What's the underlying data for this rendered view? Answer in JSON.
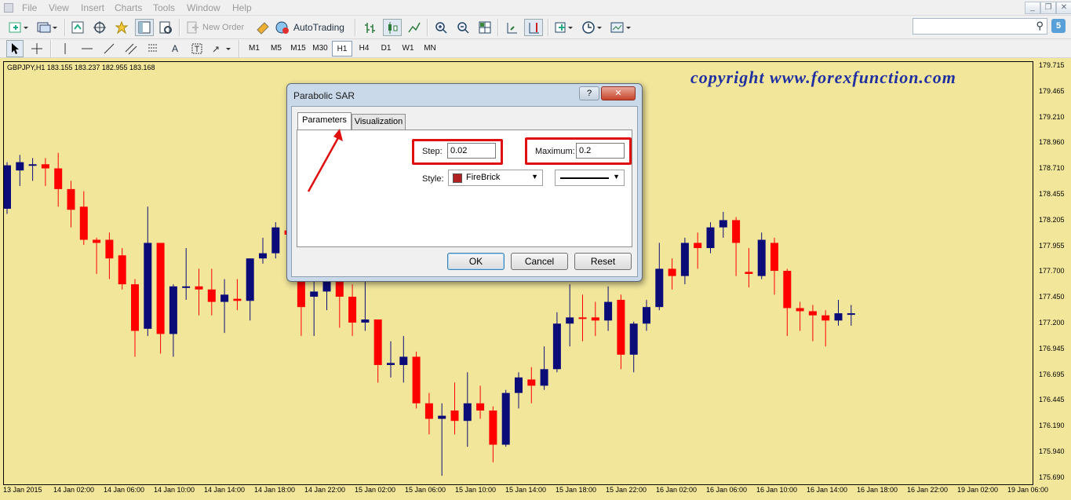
{
  "menu": [
    "File",
    "View",
    "Insert",
    "Charts",
    "Tools",
    "Window",
    "Help"
  ],
  "toolbar": {
    "new_order": "New Order",
    "autotrading": "AutoTrading",
    "search_placeholder": "",
    "badge": "5"
  },
  "timeframes": [
    "M1",
    "M5",
    "M15",
    "M30",
    "H1",
    "H4",
    "D1",
    "W1",
    "MN"
  ],
  "active_timeframe": "H1",
  "chart": {
    "info": "GBPJPY,H1  183.155 183.237 182.955 183.168",
    "copyright": "copyright  www.forexfunction.com",
    "background": "#f2e69b",
    "bull_color": "#0c0c78",
    "bear_color": "#ff0000"
  },
  "chart_data": {
    "type": "candlestick",
    "symbol": "GBPJPY",
    "timeframe": "H1",
    "ylim": [
      175.69,
      179.71
    ],
    "y_ticks": [
      "179.715",
      "179.465",
      "179.210",
      "178.960",
      "178.710",
      "178.455",
      "178.205",
      "177.955",
      "177.700",
      "177.450",
      "177.200",
      "176.945",
      "176.695",
      "176.445",
      "176.190",
      "175.940",
      "175.690"
    ],
    "x_ticks": [
      "13 Jan 2015",
      "14 Jan 02:00",
      "14 Jan 06:00",
      "14 Jan 10:00",
      "14 Jan 14:00",
      "14 Jan 18:00",
      "14 Jan 22:00",
      "15 Jan 02:00",
      "15 Jan 06:00",
      "15 Jan 10:00",
      "15 Jan 14:00",
      "15 Jan 18:00",
      "15 Jan 22:00",
      "16 Jan 02:00",
      "16 Jan 06:00",
      "16 Jan 10:00",
      "16 Jan 14:00",
      "16 Jan 18:00",
      "16 Jan 22:00",
      "19 Jan 02:00",
      "19 Jan 06:00"
    ],
    "candles": [
      {
        "o": 178.33,
        "c": 178.75,
        "h": 178.78,
        "l": 178.28
      },
      {
        "o": 178.7,
        "c": 178.78,
        "h": 178.85,
        "l": 178.55
      },
      {
        "o": 178.76,
        "c": 178.76,
        "h": 178.82,
        "l": 178.6
      },
      {
        "o": 178.76,
        "c": 178.72,
        "h": 178.82,
        "l": 178.55
      },
      {
        "o": 178.72,
        "c": 178.52,
        "h": 178.87,
        "l": 178.35
      },
      {
        "o": 178.52,
        "c": 178.32,
        "h": 178.6,
        "l": 178.15
      },
      {
        "o": 178.35,
        "c": 178.03,
        "h": 178.5,
        "l": 177.98
      },
      {
        "o": 178.03,
        "c": 178.0,
        "h": 178.05,
        "l": 177.7
      },
      {
        "o": 178.03,
        "c": 177.85,
        "h": 178.1,
        "l": 177.65
      },
      {
        "o": 177.88,
        "c": 177.6,
        "h": 177.95,
        "l": 177.55
      },
      {
        "o": 177.6,
        "c": 177.15,
        "h": 177.65,
        "l": 176.9
      },
      {
        "o": 177.17,
        "c": 178.0,
        "h": 178.35,
        "l": 177.1
      },
      {
        "o": 178.0,
        "c": 177.12,
        "h": 178.0,
        "l": 176.93
      },
      {
        "o": 177.12,
        "c": 177.58,
        "h": 177.6,
        "l": 176.9
      },
      {
        "o": 177.58,
        "c": 177.58,
        "h": 177.95,
        "l": 177.45
      },
      {
        "o": 177.58,
        "c": 177.55,
        "h": 177.75,
        "l": 177.3
      },
      {
        "o": 177.55,
        "c": 177.43,
        "h": 177.75,
        "l": 177.3
      },
      {
        "o": 177.43,
        "c": 177.5,
        "h": 177.65,
        "l": 177.13
      },
      {
        "o": 177.46,
        "c": 177.44,
        "h": 177.65,
        "l": 177.35
      },
      {
        "o": 177.44,
        "c": 177.85,
        "h": 177.85,
        "l": 177.25
      },
      {
        "o": 177.85,
        "c": 177.9,
        "h": 178.05,
        "l": 177.8
      },
      {
        "o": 177.9,
        "c": 178.15,
        "h": 178.2,
        "l": 177.85
      },
      {
        "o": 178.12,
        "c": 178.08,
        "h": 178.2,
        "l": 177.95
      },
      {
        "o": 177.63,
        "c": 177.38,
        "h": 177.7,
        "l": 177.1
      },
      {
        "o": 177.48,
        "c": 177.53,
        "h": 177.65,
        "l": 177.1
      },
      {
        "o": 177.53,
        "c": 177.63,
        "h": 177.7,
        "l": 177.35
      },
      {
        "o": 177.63,
        "c": 177.48,
        "h": 177.75,
        "l": 177.18
      },
      {
        "o": 177.48,
        "c": 177.23,
        "h": 177.6,
        "l": 177.1
      },
      {
        "o": 177.23,
        "c": 177.26,
        "h": 177.63,
        "l": 177.15
      },
      {
        "o": 177.26,
        "c": 176.82,
        "h": 177.26,
        "l": 176.65
      },
      {
        "o": 176.82,
        "c": 176.84,
        "h": 177.05,
        "l": 176.7
      },
      {
        "o": 176.82,
        "c": 176.9,
        "h": 177.1,
        "l": 176.65
      },
      {
        "o": 176.9,
        "c": 176.45,
        "h": 176.95,
        "l": 176.4
      },
      {
        "o": 176.45,
        "c": 176.3,
        "h": 176.55,
        "l": 176.15
      },
      {
        "o": 176.3,
        "c": 176.33,
        "h": 176.45,
        "l": 175.75
      },
      {
        "o": 176.38,
        "c": 176.28,
        "h": 176.65,
        "l": 176.15
      },
      {
        "o": 176.28,
        "c": 176.45,
        "h": 176.75,
        "l": 176.03
      },
      {
        "o": 176.45,
        "c": 176.38,
        "h": 176.62,
        "l": 176.3
      },
      {
        "o": 176.38,
        "c": 176.05,
        "h": 176.42,
        "l": 175.88
      },
      {
        "o": 176.05,
        "c": 176.55,
        "h": 176.58,
        "l": 176.03
      },
      {
        "o": 176.55,
        "c": 176.7,
        "h": 176.75,
        "l": 176.4
      },
      {
        "o": 176.68,
        "c": 176.62,
        "h": 176.8,
        "l": 176.45
      },
      {
        "o": 176.62,
        "c": 176.78,
        "h": 177.0,
        "l": 176.58
      },
      {
        "o": 176.78,
        "c": 177.22,
        "h": 177.33,
        "l": 176.75
      },
      {
        "o": 177.22,
        "c": 177.28,
        "h": 177.6,
        "l": 177.0
      },
      {
        "o": 177.28,
        "c": 177.27,
        "h": 177.5,
        "l": 177.05
      },
      {
        "o": 177.28,
        "c": 177.25,
        "h": 177.43,
        "l": 177.1
      },
      {
        "o": 177.25,
        "c": 177.43,
        "h": 177.58,
        "l": 177.15
      },
      {
        "o": 177.45,
        "c": 176.92,
        "h": 177.5,
        "l": 176.78
      },
      {
        "o": 176.92,
        "c": 177.22,
        "h": 177.24,
        "l": 176.75
      },
      {
        "o": 177.22,
        "c": 177.38,
        "h": 177.45,
        "l": 177.15
      },
      {
        "o": 177.38,
        "c": 177.75,
        "h": 178.0,
        "l": 177.35
      },
      {
        "o": 177.75,
        "c": 177.68,
        "h": 177.85,
        "l": 177.55
      },
      {
        "o": 177.68,
        "c": 178.0,
        "h": 178.05,
        "l": 177.6
      },
      {
        "o": 178.0,
        "c": 177.95,
        "h": 178.1,
        "l": 177.75
      },
      {
        "o": 177.95,
        "c": 178.15,
        "h": 178.2,
        "l": 177.9
      },
      {
        "o": 178.15,
        "c": 178.22,
        "h": 178.3,
        "l": 178.05
      },
      {
        "o": 178.22,
        "c": 178.0,
        "h": 178.25,
        "l": 177.68
      },
      {
        "o": 177.72,
        "c": 177.7,
        "h": 177.95,
        "l": 177.57
      },
      {
        "o": 177.68,
        "c": 178.03,
        "h": 178.1,
        "l": 177.65
      },
      {
        "o": 178.0,
        "c": 177.73,
        "h": 178.05,
        "l": 177.5
      },
      {
        "o": 177.73,
        "c": 177.37,
        "h": 177.75,
        "l": 177.1
      },
      {
        "o": 177.37,
        "c": 177.34,
        "h": 177.43,
        "l": 177.15
      },
      {
        "o": 177.34,
        "c": 177.3,
        "h": 177.4,
        "l": 177.05
      },
      {
        "o": 177.3,
        "c": 177.25,
        "h": 177.35,
        "l": 177.0
      },
      {
        "o": 177.25,
        "c": 177.32,
        "h": 177.45,
        "l": 177.2
      },
      {
        "o": 177.32,
        "c": 177.32,
        "h": 177.4,
        "l": 177.2
      }
    ]
  },
  "dialog": {
    "title": "Parabolic SAR",
    "help": "?",
    "close": "✕",
    "tabs": [
      "Parameters",
      "Visualization"
    ],
    "step_label": "Step:",
    "step_value": "0.02",
    "maximum_label": "Maximum:",
    "maximum_value": "0.2",
    "style_label": "Style:",
    "color_name": "FireBrick",
    "color_hex": "#b22222",
    "ok": "OK",
    "cancel": "Cancel",
    "reset": "Reset"
  }
}
